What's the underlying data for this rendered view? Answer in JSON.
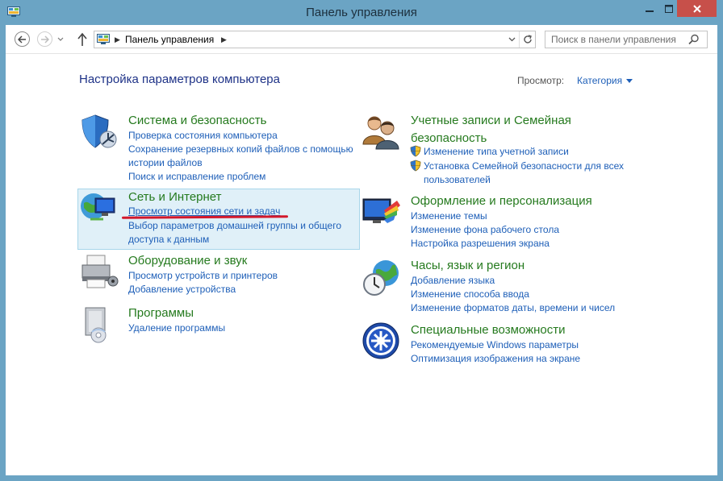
{
  "window": {
    "title": "Панель управления"
  },
  "nav": {
    "breadcrumb": "Панель управления",
    "search_placeholder": "Поиск в панели управления"
  },
  "content": {
    "page_title": "Настройка параметров компьютера",
    "view_label": "Просмотр:",
    "view_value": "Категория"
  },
  "categories": {
    "system": {
      "title": "Система и безопасность",
      "links": [
        "Проверка состояния компьютера",
        "Сохранение резервных копий файлов с помощью",
        "истории файлов",
        "Поиск и исправление проблем"
      ]
    },
    "network": {
      "title": "Сеть и Интернет",
      "links": [
        "Просмотр состояния сети и задач",
        "Выбор параметров домашней группы и общего",
        "доступа к данным"
      ]
    },
    "hardware": {
      "title": "Оборудование и звук",
      "links": [
        "Просмотр устройств и принтеров",
        "Добавление устройства"
      ]
    },
    "programs": {
      "title": "Программы",
      "links": [
        "Удаление программы"
      ]
    },
    "accounts": {
      "title_line1": "Учетные записи и Семейная",
      "title_line2": "безопасность",
      "links": [
        "Изменение типа учетной записи",
        "Установка Семейной безопасности для всех",
        "пользователей"
      ]
    },
    "appearance": {
      "title": "Оформление и персонализация",
      "links": [
        "Изменение темы",
        "Изменение фона рабочего стола",
        "Настройка разрешения экрана"
      ]
    },
    "clock": {
      "title": "Часы, язык и регион",
      "links": [
        "Добавление языка",
        "Изменение способа ввода",
        "Изменение форматов даты, времени и чисел"
      ]
    },
    "access": {
      "title": "Специальные возможности",
      "links": [
        "Рекомендуемые Windows параметры",
        "Оптимизация изображения на экране"
      ]
    }
  },
  "colors": {
    "frame": "#6ba4c4",
    "close": "#c7504a",
    "category_title": "#257a1e",
    "link": "#1e5fb8",
    "page_title": "#1e3287",
    "annotation": "#d3182b"
  }
}
